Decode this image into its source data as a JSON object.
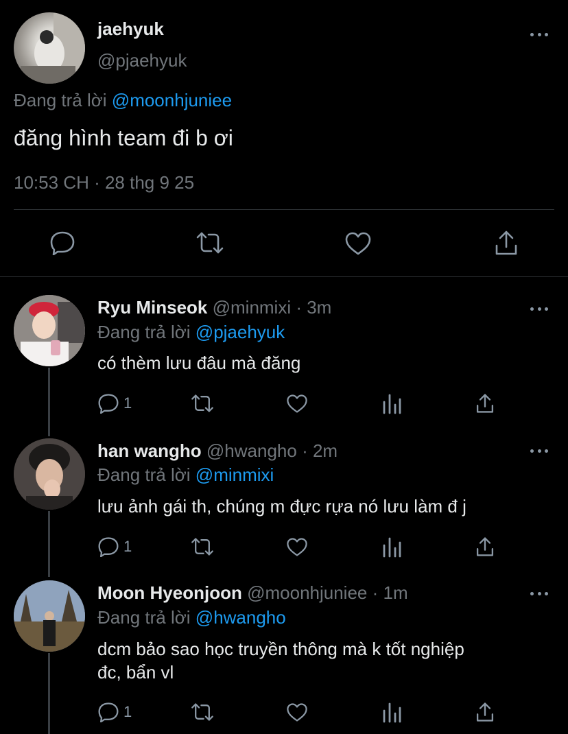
{
  "main_tweet": {
    "name": "jaehyuk",
    "handle": "@pjaehyuk",
    "reply_prefix": "Đang trả lời",
    "reply_to": "@moonhjuniee",
    "text": "đăng hình team đi b ơi",
    "timestamp": "10:53 CH · 28 thg 9 25"
  },
  "replies": [
    {
      "name": "Ryu Minseok",
      "handle": "@minmixi",
      "time": "· 3m",
      "reply_prefix": "Đang trả lời",
      "reply_to": "@pjaehyuk",
      "text_lines": [
        "có thèm lưu đâu mà đăng"
      ],
      "reply_count": "1"
    },
    {
      "name": "han wangho",
      "handle": "@hwangho",
      "time": "· 2m",
      "reply_prefix": "Đang trả lời",
      "reply_to": "@minmixi",
      "text_lines": [
        "lưu ảnh gái th, chúng m đực rựa nó lưu làm đ j"
      ],
      "reply_count": "1"
    },
    {
      "name": "Moon Hyeonjoon",
      "handle": "@moonhjuniee",
      "time": "· 1m",
      "reply_prefix": "Đang trả lời",
      "reply_to": "@hwangho",
      "text_lines": [
        "dcm bảo sao học truyền thông mà k tốt nghiệp",
        "đc, bẩn vl"
      ],
      "reply_count": "1"
    }
  ],
  "colors": {
    "background": "#000000",
    "text": "#e7e9ea",
    "secondary": "#71767b",
    "link": "#1d9bf0",
    "divider": "#2f3336"
  },
  "icons": [
    "comment-icon",
    "retweet-icon",
    "like-icon",
    "share-icon",
    "views-icon",
    "more-icon"
  ]
}
